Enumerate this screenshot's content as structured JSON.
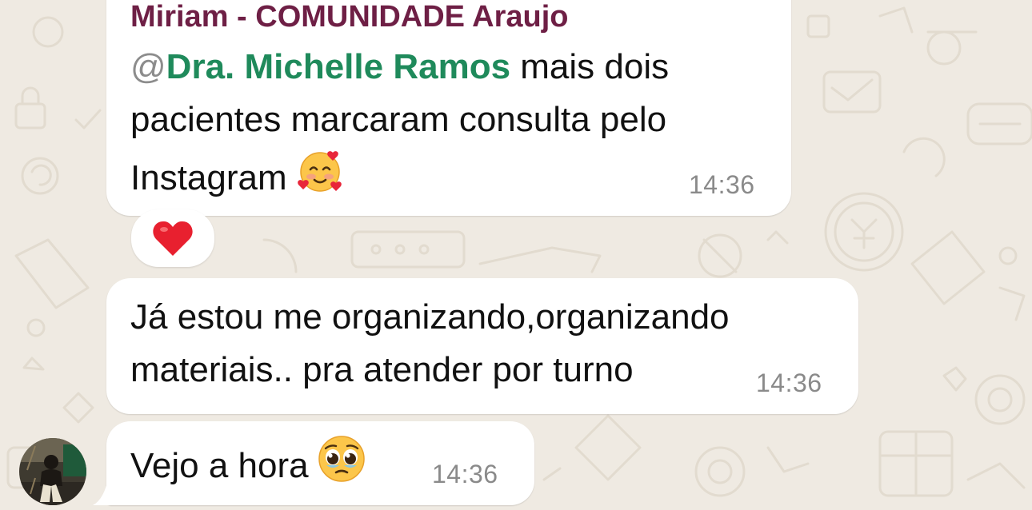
{
  "messages": [
    {
      "sender": "Miriam - COMUNIDADE Araujo",
      "mention_at": "@",
      "mention_name": "Dra. Michelle Ramos",
      "line1_rest": " mais dois",
      "line2": "pacientes marcaram consulta pelo",
      "line3": "Instagram",
      "emoji": "smiling-face-with-hearts",
      "time": "14:36",
      "reaction": "red-heart"
    },
    {
      "line1": "Já estou me organizando,organizando",
      "line2": "materiais.. pra atender por turno",
      "time": "14:36"
    },
    {
      "line1": "Vejo a hora",
      "emoji": "pleading-face",
      "time": "14:36"
    }
  ],
  "colors": {
    "background": "#efeae2",
    "bubble": "#ffffff",
    "sender_name": "#6e1f45",
    "mention": "#1f8a5b",
    "timestamp": "#8a8a8a"
  }
}
